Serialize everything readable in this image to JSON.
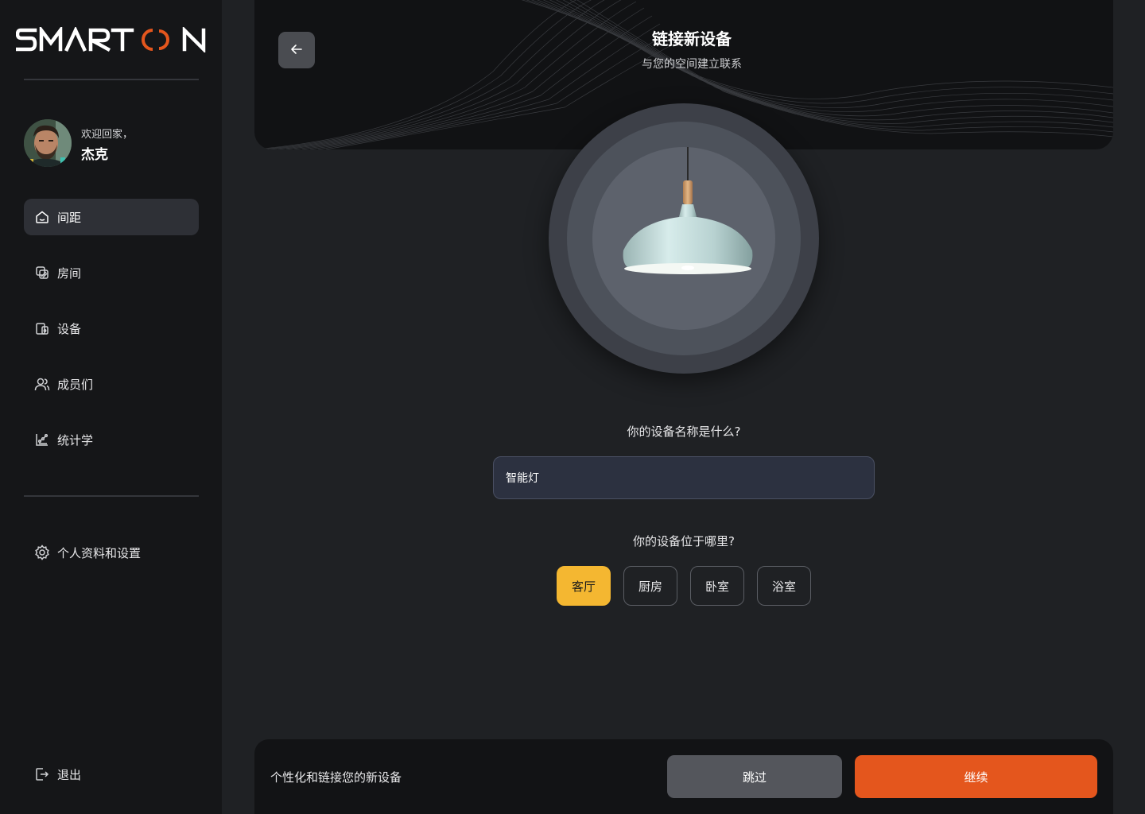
{
  "brand": {
    "logo_text": "SMARTOON",
    "accent": "#e4561d"
  },
  "user": {
    "welcome": "欢迎回家，",
    "name": "杰克"
  },
  "sidebar": {
    "items": [
      {
        "label": "间距",
        "icon": "home-icon",
        "active": true
      },
      {
        "label": "房间",
        "icon": "rooms-icon",
        "active": false
      },
      {
        "label": "设备",
        "icon": "devices-icon",
        "active": false
      },
      {
        "label": "成员们",
        "icon": "users-icon",
        "active": false
      },
      {
        "label": "统计学",
        "icon": "stats-icon",
        "active": false
      }
    ],
    "settings_label": "个人资料和设置",
    "logout_label": "退出"
  },
  "header": {
    "title": "链接新设备",
    "subtitle": "与您的空间建立联系",
    "back_icon": "arrow-left-icon"
  },
  "form": {
    "name_question": "你的设备名称是什么?",
    "name_value": "智能灯",
    "location_question": "你的设备位于哪里?",
    "rooms": [
      {
        "label": "客厅",
        "selected": true
      },
      {
        "label": "厨房",
        "selected": false
      },
      {
        "label": "卧室",
        "selected": false
      },
      {
        "label": "浴室",
        "selected": false
      }
    ],
    "selected_color": "#f4b731"
  },
  "footer": {
    "text": "个性化和链接您的新设备",
    "skip_label": "跳过",
    "continue_label": "继续"
  }
}
